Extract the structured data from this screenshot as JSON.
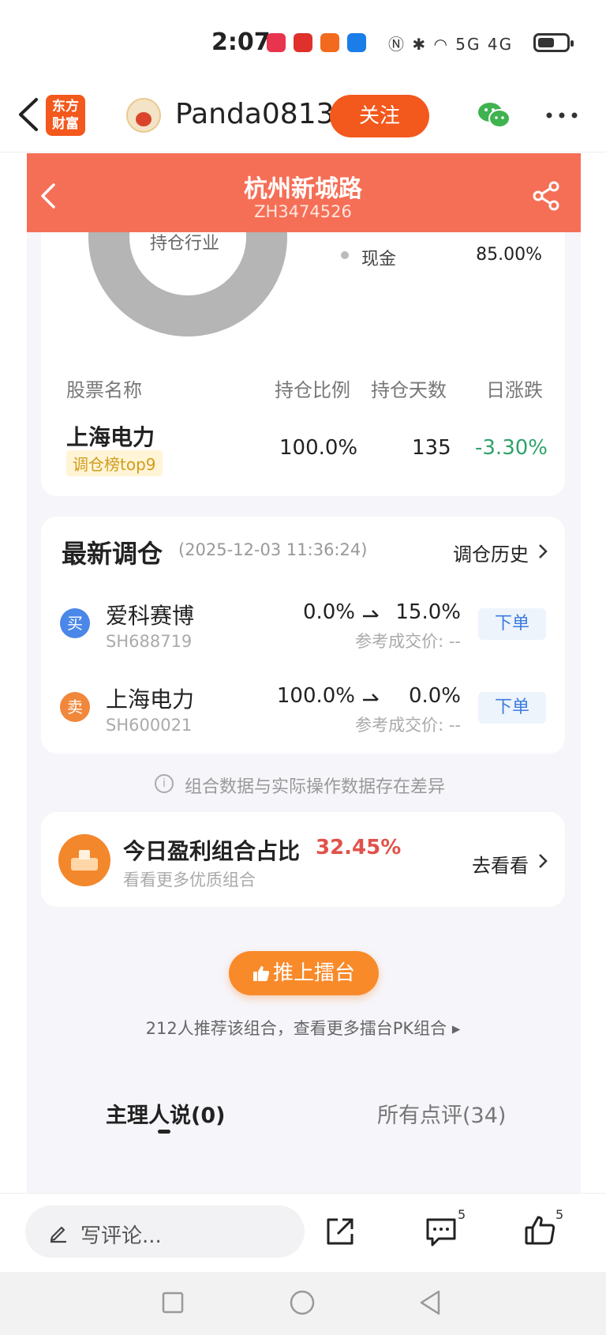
{
  "status_bar": {
    "time": "2:07",
    "battery_level": 0.5,
    "app_badges": [
      {
        "name": "app-badge-1",
        "color": "#e8344d"
      },
      {
        "name": "app-badge-2",
        "color": "#e0302b"
      },
      {
        "name": "app-badge-3",
        "color": "#f26a1e"
      },
      {
        "name": "app-badge-4",
        "color": "#1a7de8"
      }
    ],
    "signal_text": "5G 4G"
  },
  "nav": {
    "brand_line1": "东方",
    "brand_line2": "财富",
    "username": "Panda0813",
    "follow_label": "关注"
  },
  "portfolio": {
    "title": "杭州新城路",
    "code": "ZH3474526"
  },
  "allocation": {
    "donut_label": "持仓行业",
    "legend": [
      {
        "name": "现金",
        "value": "85.00%"
      }
    ]
  },
  "holdings": {
    "headers": [
      "股票名称",
      "持仓比例",
      "持仓天数",
      "日涨跌"
    ],
    "rows": [
      {
        "name": "上海电力",
        "tag": "调仓榜top9",
        "ratio": "100.0%",
        "days": "135",
        "change": "-3.30%"
      }
    ]
  },
  "adjust": {
    "title": "最新调仓",
    "time": "(2025-12-03 11:36:24)",
    "history_label": "调仓历史",
    "trades": [
      {
        "badge": "买",
        "badge_color": "#4a87e8",
        "name": "爱科赛博",
        "code": "SH688719",
        "from": "0.0%",
        "to": "15.0%",
        "ref": "参考成交价: --",
        "order_label": "下单"
      },
      {
        "badge": "卖",
        "badge_color": "#f1873a",
        "name": "上海电力",
        "code": "SH600021",
        "from": "100.0%",
        "to": "0.0%",
        "ref": "参考成交价: --",
        "order_label": "下单"
      }
    ]
  },
  "notice": "组合数据与实际操作数据存在差异",
  "profit": {
    "title": "今日盈利组合占比",
    "value": "32.45%",
    "subtitle": "看看更多优质组合",
    "action": "去看看"
  },
  "push": {
    "label": "推上擂台",
    "recommend_text": "212人推荐该组合，查看更多擂台PK组合 ▸"
  },
  "tabs": [
    {
      "label": "主理人说(0)",
      "active": true
    },
    {
      "label": "所有点评(34)",
      "active": false
    }
  ],
  "bottom_bar": {
    "comment_placeholder": "写评论...",
    "comment_count": "5",
    "like_count": "5"
  },
  "colors": {
    "brand": "#f3581c",
    "header": "#f56f56",
    "down": "#2ea36a",
    "accent_red": "#e0524a"
  }
}
